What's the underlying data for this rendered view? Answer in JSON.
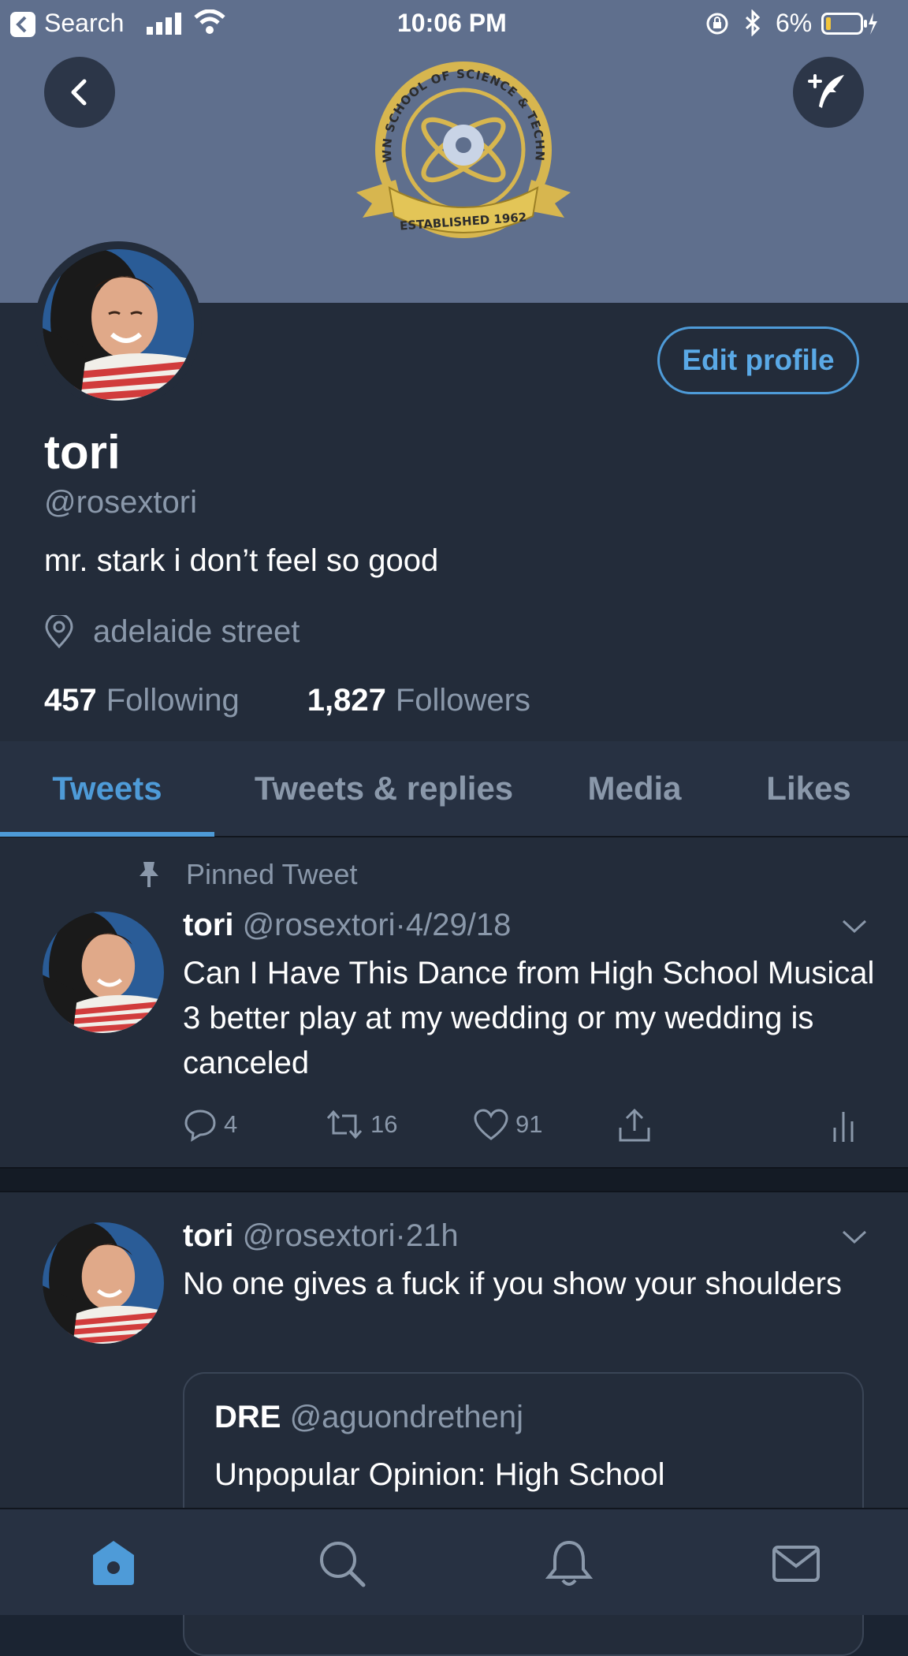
{
  "statusbar": {
    "back_app": "Search",
    "time": "10:06 PM",
    "battery": "6%"
  },
  "banner": {
    "emblem_top_text": "MIDTOWN SCHOOL OF SCIENCE & TECHNOLOGY",
    "emblem_ribbon_text": "ESTABLISHED 1962"
  },
  "profile": {
    "edit_button": "Edit profile",
    "display_name": "tori",
    "handle": "@rosextori",
    "bio": "mr. stark i don’t feel so good",
    "location": "adelaide street",
    "following_count": "457",
    "following_label": "Following",
    "followers_count": "1,827",
    "followers_label": "Followers"
  },
  "tabs": [
    {
      "label": "Tweets",
      "active": true
    },
    {
      "label": "Tweets & replies",
      "active": false
    },
    {
      "label": "Media",
      "active": false
    },
    {
      "label": "Likes",
      "active": false
    }
  ],
  "tweets": [
    {
      "pinned_label": "Pinned Tweet",
      "name": "tori",
      "handle": "@rosextori",
      "sep": "·",
      "time": "4/29/18",
      "text": "Can I Have This Dance from High School Musical 3 better play at my wedding or my wedding is canceled",
      "replies": "4",
      "retweets": "16",
      "likes": "91"
    },
    {
      "name": "tori",
      "handle": "@rosextori",
      "sep": "·",
      "time": "21h",
      "text": "No one gives a fuck if you show your shoulders",
      "quote": {
        "name": "DRE",
        "handle": "@aguondrethenj",
        "text": "Unpopular Opinion: High School"
      }
    }
  ],
  "colors": {
    "accent": "#4e9bd8",
    "background": "#1b2432",
    "banner": "#5f6f8d"
  },
  "bottom_nav": [
    "home-icon",
    "search-icon",
    "bell-icon",
    "mail-icon"
  ]
}
